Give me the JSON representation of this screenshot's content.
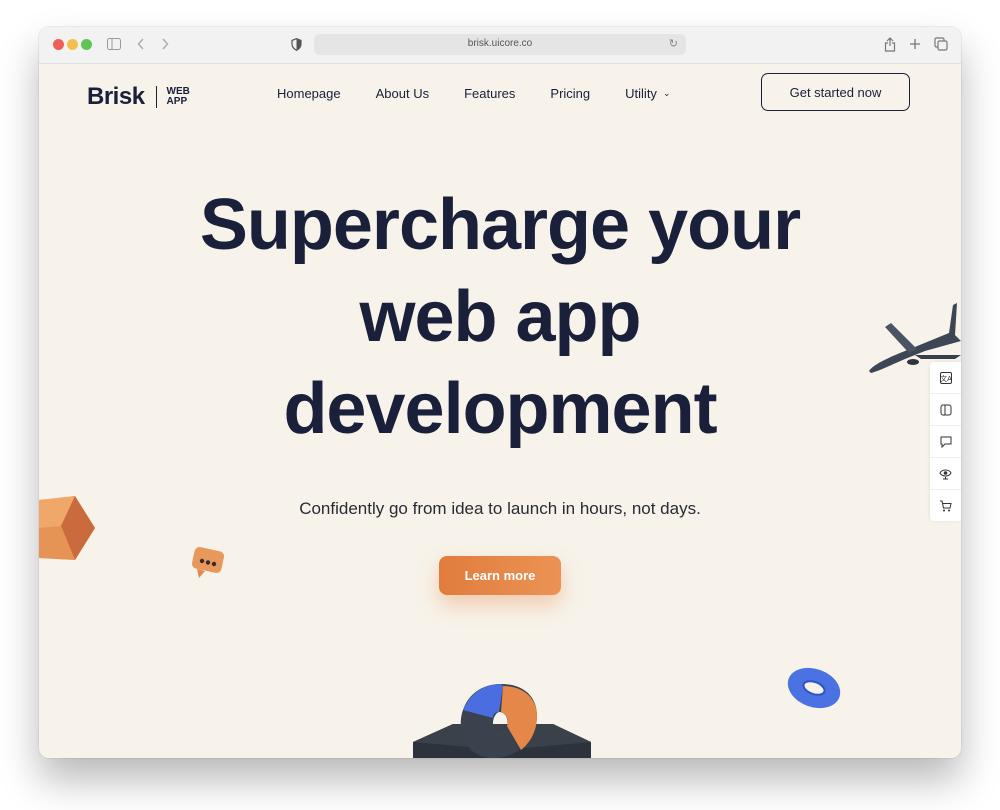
{
  "browser": {
    "url": "brisk.uicore.co",
    "icons": [
      "sidebar-icon",
      "back-icon",
      "forward-icon",
      "shield-icon",
      "reload-icon",
      "share-icon",
      "new-tab-icon",
      "tabs-icon"
    ]
  },
  "header": {
    "logo": {
      "word": "Brisk",
      "sub_line1": "WEB",
      "sub_line2": "APP"
    },
    "nav": [
      {
        "label": "Homepage"
      },
      {
        "label": "About Us"
      },
      {
        "label": "Features"
      },
      {
        "label": "Pricing"
      },
      {
        "label": "Utility",
        "has_dropdown": true
      }
    ],
    "cta_label": "Get started now"
  },
  "hero": {
    "headline_lines": [
      "Supercharge your",
      "web app",
      "development"
    ],
    "subtitle": "Confidently go from idea to launch in hours, not days.",
    "button_label": "Learn more"
  },
  "side_tools": [
    {
      "icon": "translate-icon"
    },
    {
      "icon": "book-icon"
    },
    {
      "icon": "chat-icon"
    },
    {
      "icon": "eye-icon"
    },
    {
      "icon": "cart-icon"
    }
  ],
  "colors": {
    "background": "#f7f3ea",
    "text": "#1a1f3a",
    "accent": "#e5843f",
    "blue": "#4a6ee0"
  }
}
